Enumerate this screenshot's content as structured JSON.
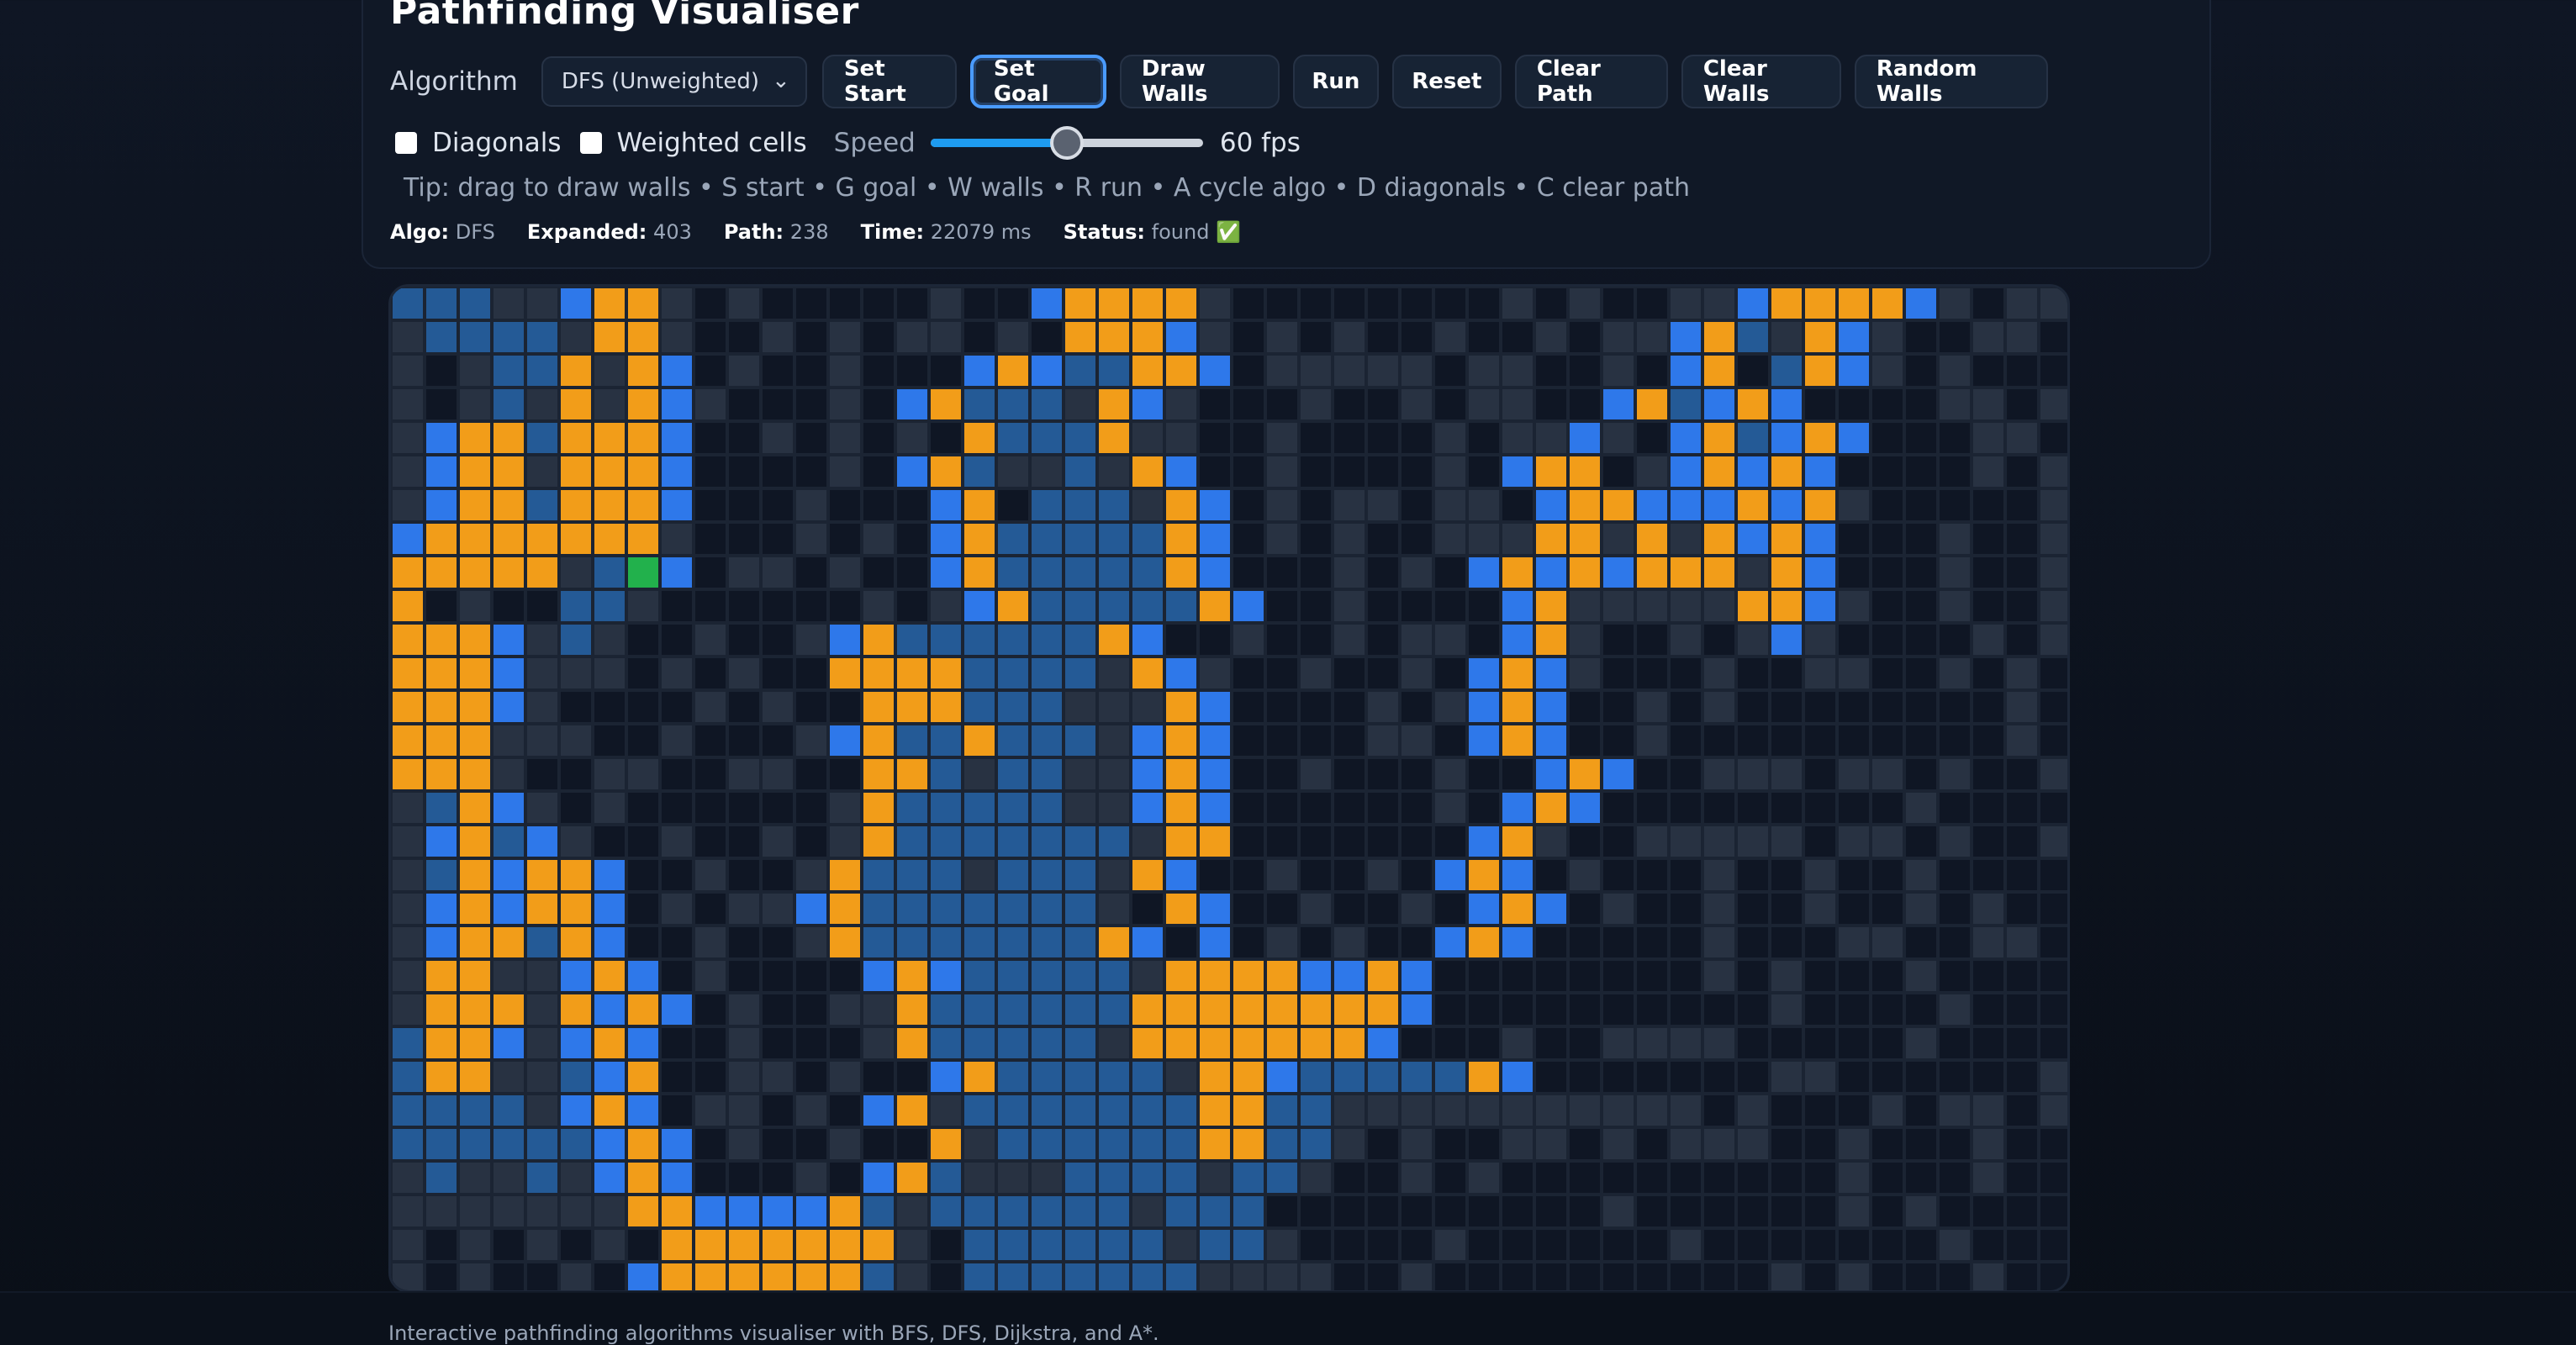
{
  "app": {
    "title": "Pathfinding Visualiser"
  },
  "toolbar": {
    "algorithm_label": "Algorithm",
    "algorithm_value": "DFS (Unweighted)",
    "buttons": [
      "Set Start",
      "Set Goal",
      "Draw Walls",
      "Run",
      "Reset",
      "Clear Path",
      "Clear Walls",
      "Random Walls"
    ],
    "active_button": "Set Goal"
  },
  "options": {
    "diagonals_label": "Diagonals",
    "diagonals_checked": false,
    "weighted_label": "Weighted cells",
    "weighted_checked": false,
    "speed_label": "Speed",
    "speed_value": "60 fps",
    "speed_fraction": 0.5
  },
  "tip": "Tip: drag to draw walls • S start • G goal • W walls • R run • A cycle algo • D diagonals • C clear path",
  "stats": {
    "algo_label": "Algo:",
    "algo_value": "DFS",
    "expanded_label": "Expanded:",
    "expanded_value": "403",
    "path_label": "Path:",
    "path_value": "238",
    "time_label": "Time:",
    "time_value": "22079 ms",
    "status_label": "Status:",
    "status_value": "found ✅"
  },
  "grid": {
    "cols": 50,
    "rows": 30,
    "colors": {
      "empty": "#0f1624",
      "wall": "#283242",
      "visited": "#245a96",
      "frontier": "#2e78ea",
      "path": "#f29d19",
      "goal": "#22b14c",
      "gridline": "#1b2433"
    },
    "rows_data": [
      "VVVWWFPPW.W.....W..FPPPPW........W.W..WWFPPPPFW.WWW",
      "WVVVVWPPW..W.W.WW.W.PPPFW.W.W..W..W.WWFPVWPFW..WW.",
      "W.WVVPWPF.W..W...FPFVVPPF.WWWWW.WW..W.FP.VPFW.W....",
      "W.WVWPWPFW...W.FPVVVWPFW...W..W.WW..FPVFPF....WW.W",
      "WFPPVPPPF..W.W.W.PVVVPWW..W....W.WWFW.FPVFPF...WW.W",
      "WFPPWPPPF....W.FPVWWVWPF..W....W.FPP.WFPFPF....W.W",
      "WFPPVPPPF...W...FP.VVVWPF.W.WW.WW.FPPFFFPFPW.....W",
      "FPPPPPPPW...W.W.FPVVVVVPF.W.W..WWWPPWPWPFPF...W..W",
      "PPPPPWVGF.WW.W..FPVVVVVPF...W.W.FPFPFPPPWPF...W..W",
      "P.W..VVW......W.WFPVVVVVPF..W....FPWWWWWPPFW..W..W",
      "PPPFWVW..W..WFPVVVVVVPF..W..W.WW.FPW..W.WFW....W.W",
      "PPPFWWW.W.W..PPPPVVVVWPFW..W..W.FPFW...W..WW..W.W",
      "PPPFW....W.W..PPPVVVWWWPF....W.WFPF..W.W........W.",
      "PPPWWW..W...WFPVVPVVVWFPF....WW.FPF..W..........W",
      "PPPW..WW..WW..PPVWVVWWFPF..W...W..FPF..WWW.WW.W..W",
      "WVPFW.W......WPVVVVVWWFPF......W.FPF.........W...",
      "WFPVFW..W..W.WPVVVVVVVWPP.......FPW..WWWWW.WW.W..W",
      "WVPFPPF..W..WPVVVWVVVWPF..W..W.FPF.W...W..W..W...",
      "WFPFPPF.W.WWFPVVVVVVVW.PF..W..W.FPF.W..W..W..W.W",
      "WFPPVPF..W..WPVVVVVVVPF.F.W.W..FPF.....W...WW..WW.",
      "WPPWWFPF.W....FPFVVVVVWPPPPFFPF........W.W...W....",
      "WPPPWPFPF.W..WWPVVVVVVPPPPPPPPF..........W....W...",
      "VPPFWFPF..W...WPVVVVVWPPPPPPPF...W..WWWW.....W...",
      "VPPWWVFP..WW.W..FPVVVVVWPPFVVVVVPF.......WW......W",
      "VVVVWFPF.WW.W.FPWVVVVVVVPPVVWWWWWWWWWWW.W...W.WW.W",
      "VVVVVVFPF.W..W..PWVVVVVVPPVVW.W..WW.W.WWW..W...W.",
      "WVWWVWFPF...W.FPVWWWVVVVWVVW..W.W..........W...W..",
      "WWWWWWWPPFFFFPVWVVVVVVWVVV..........W......W.W...",
      "W.W.W.W.PPPPPPPW.VVVVVVWVVW....W......W.......W...",
      "W.W..W.FPPPPPPVW.VVVVVVVWWWW..W..........W.W...W"
    ]
  },
  "footer": {
    "text": "Interactive pathfinding algorithms visualiser with BFS, DFS, Dijkstra, and A*."
  }
}
